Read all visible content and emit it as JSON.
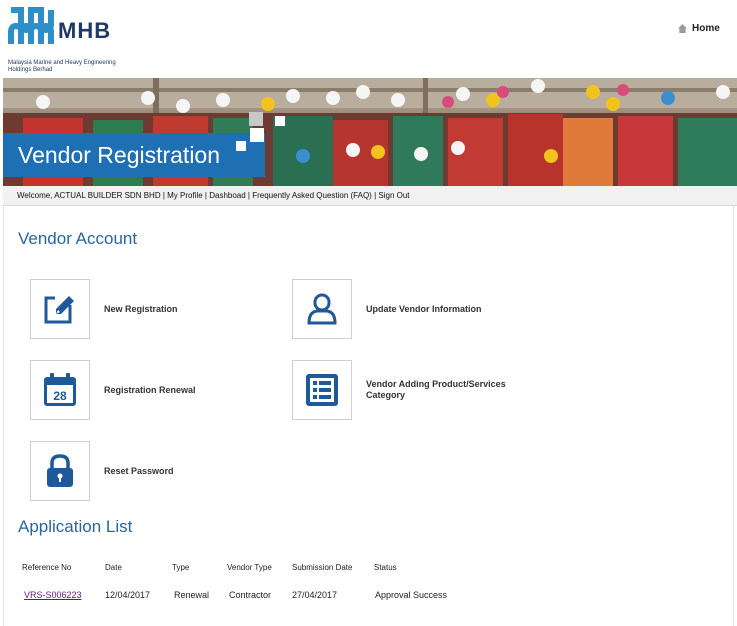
{
  "header": {
    "logo_word": "MHB",
    "logo_subtitle": "Malaysia Marine and Heavy Engineering Holdings Berhad",
    "home_label": "Home"
  },
  "banner": {
    "title": "Vendor Registration"
  },
  "nav": {
    "welcome": "Welcome, ACTUAL BUILDER SDN BHD",
    "links": [
      "My Profile",
      "Dashboad",
      "Frequently Asked Question (FAQ)",
      "Sign Out"
    ],
    "separator": " | "
  },
  "vendor_account": {
    "title": "Vendor Account",
    "tiles": [
      {
        "label": "New Registration",
        "icon": "edit-icon"
      },
      {
        "label": "Update Vendor Information",
        "icon": "user-icon"
      },
      {
        "label": "Registration Renewal",
        "icon": "calendar-icon",
        "calendar_day": "28"
      },
      {
        "label": "Vendor Adding Product/Services Category",
        "icon": "list-icon"
      },
      {
        "label": "Reset Password",
        "icon": "lock-icon"
      }
    ]
  },
  "application_list": {
    "title": "Application List",
    "columns": [
      "Reference No",
      "Date",
      "Type",
      "Vendor Type",
      "Submission Date",
      "Status"
    ],
    "rows": [
      [
        "VRS-S006223",
        "12/04/2017",
        "Renewal",
        "Contractor",
        "27/04/2017",
        "Approval Success"
      ]
    ]
  },
  "colors": {
    "accent": "#1e6fb4",
    "title_blue": "#2666a6",
    "link_purple": "#5a1a7a",
    "logo_navy": "#1f3a66"
  }
}
